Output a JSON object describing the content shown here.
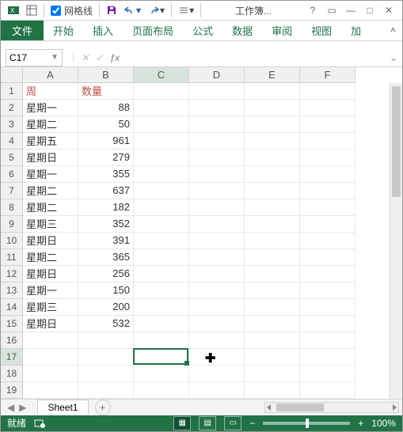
{
  "qat": {
    "gridlines_label": "网格线",
    "gridlines_checked": true
  },
  "workbook_title": "工作簿...",
  "ribbon_tabs": {
    "file": "文件",
    "t0": "开始",
    "t1": "插入",
    "t2": "页面布局",
    "t3": "公式",
    "t4": "数据",
    "t5": "审阅",
    "t6": "视图",
    "t7": "加"
  },
  "namebox": "C17",
  "columns": [
    "A",
    "B",
    "C",
    "D",
    "E",
    "F"
  ],
  "headers": {
    "A": "周",
    "B": "数量"
  },
  "rows": [
    {
      "A": "星期一",
      "B": "88"
    },
    {
      "A": "星期二",
      "B": "50"
    },
    {
      "A": "星期五",
      "B": "961"
    },
    {
      "A": "星期日",
      "B": "279"
    },
    {
      "A": "星期一",
      "B": "355"
    },
    {
      "A": "星期二",
      "B": "637"
    },
    {
      "A": "星期二",
      "B": "182"
    },
    {
      "A": "星期三",
      "B": "352"
    },
    {
      "A": "星期日",
      "B": "391"
    },
    {
      "A": "星期二",
      "B": "365"
    },
    {
      "A": "星期日",
      "B": "256"
    },
    {
      "A": "星期一",
      "B": "150"
    },
    {
      "A": "星期三",
      "B": "200"
    },
    {
      "A": "星期日",
      "B": "532"
    }
  ],
  "total_rows_visible": 19,
  "selection": {
    "col": "C",
    "row": 17
  },
  "sheet": {
    "name": "Sheet1"
  },
  "status": {
    "ready": "就绪",
    "zoom": "100%"
  }
}
